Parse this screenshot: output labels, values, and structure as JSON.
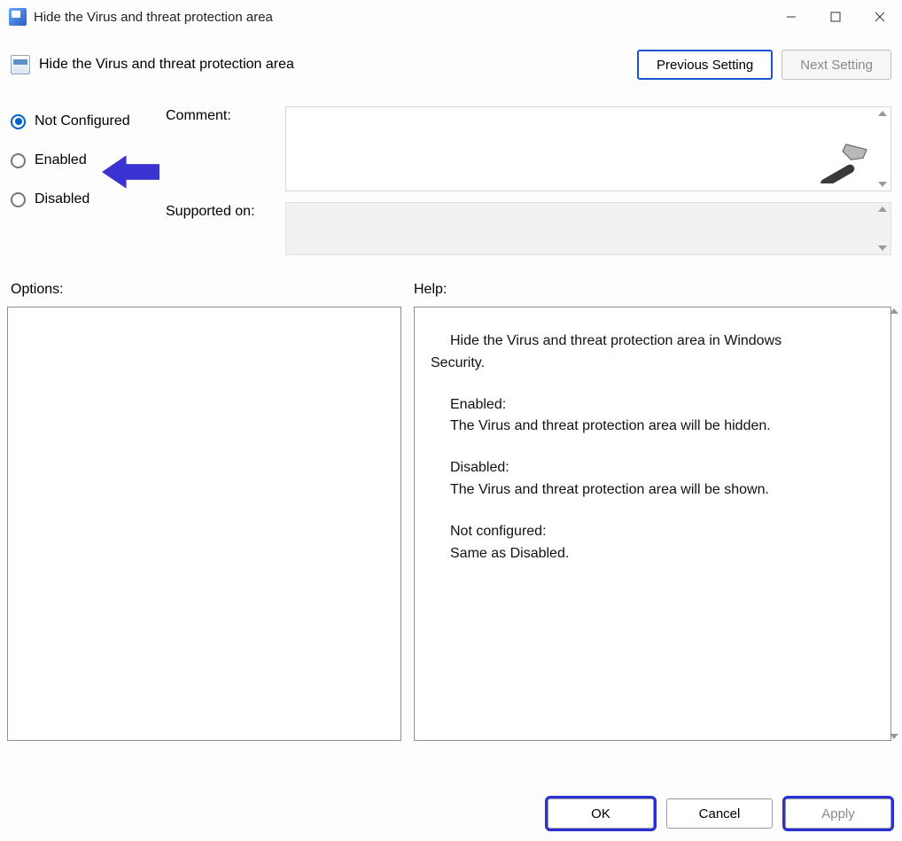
{
  "window": {
    "title": "Hide the Virus and threat protection area"
  },
  "header": {
    "title": "Hide the Virus and threat protection area"
  },
  "nav": {
    "previous": "Previous Setting",
    "next": "Next Setting"
  },
  "state": {
    "options": [
      {
        "label": "Not Configured",
        "selected": true
      },
      {
        "label": "Enabled",
        "selected": false
      },
      {
        "label": "Disabled",
        "selected": false
      }
    ]
  },
  "labels": {
    "comment": "Comment:",
    "supported": "Supported on:",
    "options": "Options:",
    "help": "Help:"
  },
  "comment": {
    "value": ""
  },
  "supported": {
    "value": ""
  },
  "help": {
    "intro_indent": "Hide the Virus and threat protection area in Windows",
    "intro_rest": "Security.",
    "enabled_head": "Enabled:",
    "enabled_body": "The Virus and threat protection area will be hidden.",
    "disabled_head": "Disabled:",
    "disabled_body": "The Virus and threat protection area will be shown.",
    "notconf_head": "Not configured:",
    "notconf_body": "Same as Disabled."
  },
  "footer": {
    "ok": "OK",
    "cancel": "Cancel",
    "apply": "Apply"
  },
  "annotation": {
    "arrow_color": "#3a33d1"
  }
}
